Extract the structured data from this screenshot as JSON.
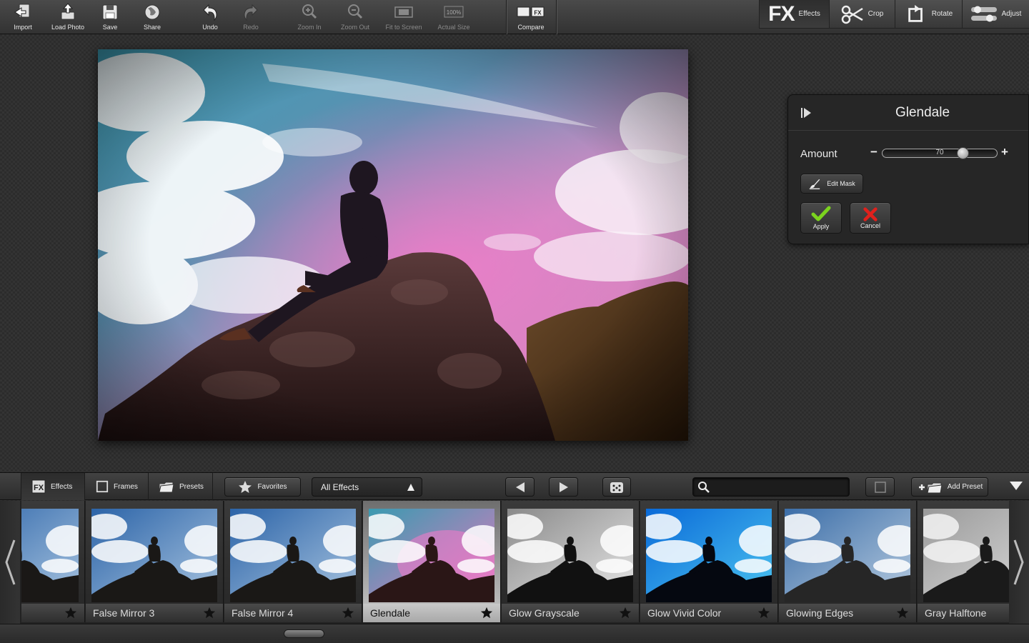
{
  "toolbar": {
    "import": "Import",
    "load_photo": "Load Photo",
    "save": "Save",
    "share": "Share",
    "undo": "Undo",
    "redo": "Redo",
    "zoom_in": "Zoom In",
    "zoom_out": "Zoom Out",
    "fit_to_screen": "Fit to Screen",
    "actual_size": "Actual Size",
    "actual_size_badge": "100%",
    "compare": "Compare",
    "compare_badge": "FX"
  },
  "modes": {
    "effects_big": "FX",
    "effects": "Effects",
    "crop": "Crop",
    "rotate": "Rotate",
    "adjust": "Adjust"
  },
  "panel": {
    "title": "Glendale",
    "amount_label": "Amount",
    "minus": "−",
    "plus": "+",
    "amount_value": "70",
    "amount_fraction": 0.7,
    "edit_mask": "Edit Mask",
    "apply": "Apply",
    "cancel": "Cancel"
  },
  "bottombar": {
    "tab_effects": "Effects",
    "tab_frames": "Frames",
    "tab_presets": "Presets",
    "favorites": "Favorites",
    "filter_selected": "All Effects",
    "search_placeholder": "",
    "add_preset": "Add Preset"
  },
  "thumbnails": [
    {
      "label": "",
      "style": "normal"
    },
    {
      "label": "False Mirror 3",
      "style": "normal"
    },
    {
      "label": "False Mirror 4",
      "style": "normal"
    },
    {
      "label": "Glendale",
      "style": "glendale",
      "selected": true
    },
    {
      "label": "Glow Grayscale",
      "style": "gray"
    },
    {
      "label": "Glow Vivid Color",
      "style": "vivid"
    },
    {
      "label": "Glowing Edges",
      "style": "edges"
    },
    {
      "label": "Gray Halftone",
      "style": "halftone"
    }
  ],
  "colors": {
    "apply_check": "#7bd31e",
    "cancel_x": "#e0201c"
  }
}
